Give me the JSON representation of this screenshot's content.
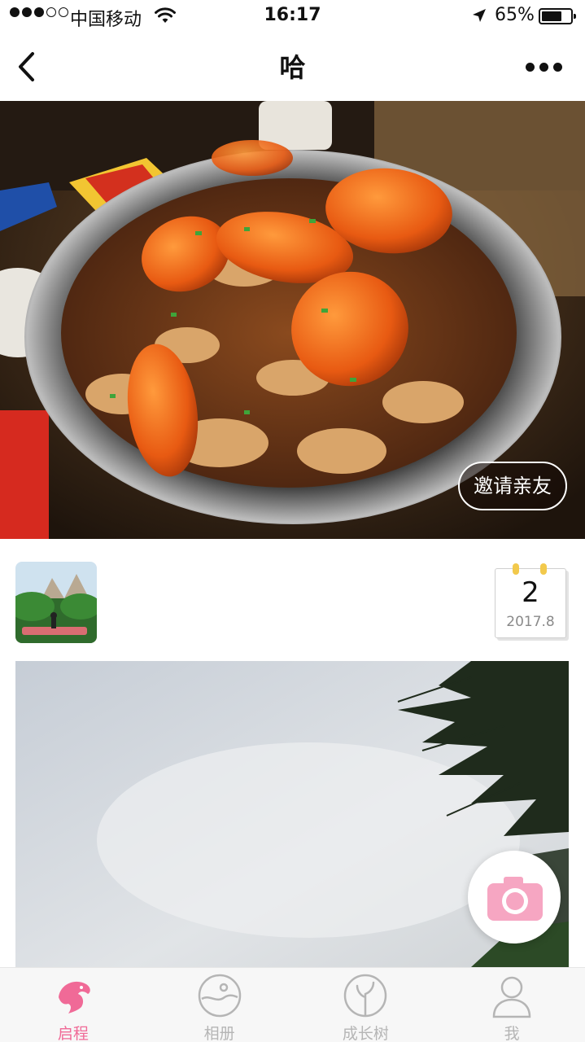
{
  "status_bar": {
    "carrier": "中国移动",
    "time": "16:17",
    "battery_percent": "65%",
    "battery_level": 0.65,
    "signal_bars": 3,
    "signal_total": 5
  },
  "nav": {
    "title": "哈",
    "back_icon": "chevron-left-icon",
    "more_icon": "more-horizontal-icon"
  },
  "cover": {
    "image_subject": "crab-dish-photo",
    "invite_label": "邀请亲友"
  },
  "entry": {
    "date_day": "2",
    "date_year_month": "2017.8",
    "photo_subject": "cloudy-sky-with-pine-branches"
  },
  "fab": {
    "icon": "camera-icon"
  },
  "tabs": [
    {
      "label": "启程",
      "icon": "dolphin-icon",
      "active": true
    },
    {
      "label": "相册",
      "icon": "album-face-icon",
      "active": false
    },
    {
      "label": "成长树",
      "icon": "growth-tree-icon",
      "active": false
    },
    {
      "label": "我",
      "icon": "person-icon",
      "active": false
    }
  ],
  "colors": {
    "accent": "#f06a97",
    "tab_inactive": "#b5b5b5",
    "camera": "#f6a6c2"
  }
}
